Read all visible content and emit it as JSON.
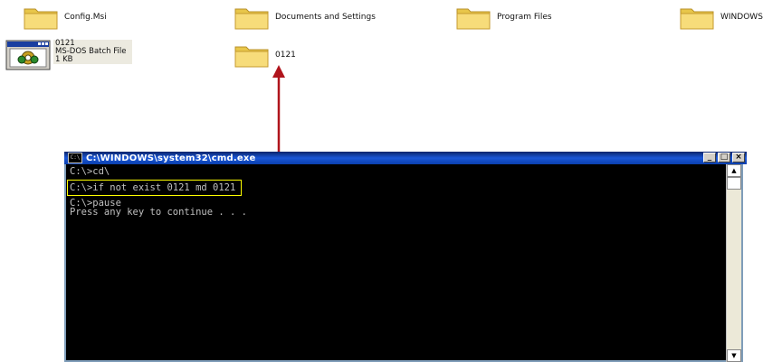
{
  "explorer": {
    "folders": [
      {
        "name": "Config.Msi"
      },
      {
        "name": "Documents and Settings"
      },
      {
        "name": "Program Files"
      },
      {
        "name": "WINDOWS"
      }
    ],
    "bat_file": {
      "name": "0121",
      "type": "MS-DOS Batch File",
      "size": "1 KB"
    },
    "new_folder": {
      "name": "0121"
    }
  },
  "cmd": {
    "title": "C:\\WINDOWS\\system32\\cmd.exe",
    "icon_text": "C:\\",
    "minimize": "_",
    "maximize": "□",
    "close": "×",
    "lines": [
      "C:\\>cd\\",
      "C:\\>if not exist 0121 md 0121",
      "C:\\>pause",
      "Press any key to continue . . ."
    ]
  },
  "colors": {
    "highlight": "#ffff00",
    "arrow": "#b0141c",
    "titlebar": "#0a3fae"
  }
}
